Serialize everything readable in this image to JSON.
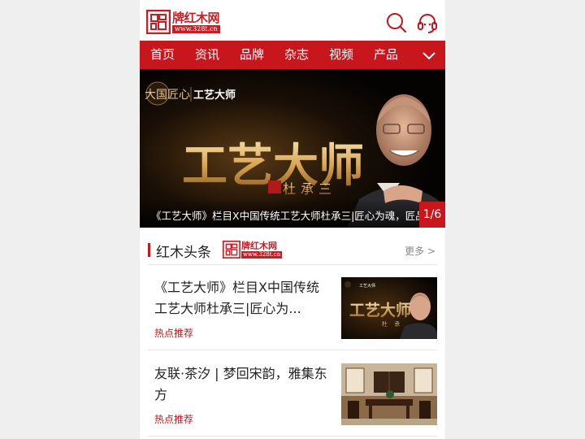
{
  "header": {
    "logo_name": "牌红木网",
    "logo_url": "www.328t.cn",
    "search_icon": "search-icon",
    "service_icon": "customer-service-icon"
  },
  "nav": {
    "items": [
      {
        "label": "首页"
      },
      {
        "label": "资讯"
      },
      {
        "label": "品牌"
      },
      {
        "label": "杂志"
      },
      {
        "label": "视频"
      },
      {
        "label": "产品"
      }
    ],
    "more_icon": "chevron-down-icon"
  },
  "banner": {
    "brand_left": "大国匠心",
    "brand_right": "工艺大师",
    "headline": "工艺大师",
    "seal": "大国匠心",
    "person_name": "杜承三",
    "caption": "《工艺大师》栏目X中国传统工艺大师杜承三|匠心为魂，匠品",
    "page_indicator": "1/6"
  },
  "section": {
    "title": "红木头条",
    "logo_name": "牌红木网",
    "logo_url": "www.328t.cn",
    "more_label": "更多 >"
  },
  "news": [
    {
      "title": "《工艺大师》栏目X中国传统工艺大师杜承三|匠心为...",
      "tag": "热点推荐"
    },
    {
      "title": "友联·茶汐 | 梦回宋韵，雅集东方",
      "tag": "热点推荐"
    }
  ],
  "thumb1": {
    "brand": "工艺大师",
    "headline": "工艺大师",
    "person_name": "杜 承"
  },
  "colors": {
    "brand_red": "#c8161d",
    "gold": "#e2b46a"
  }
}
